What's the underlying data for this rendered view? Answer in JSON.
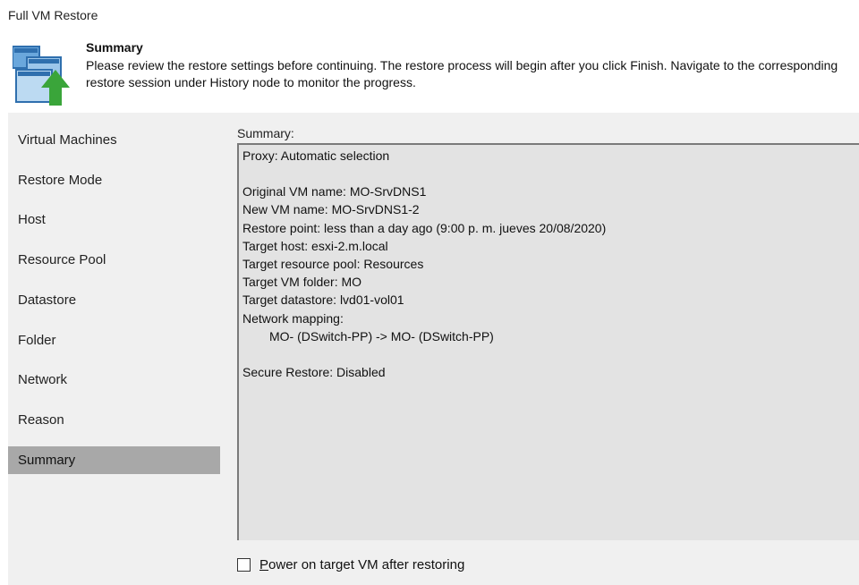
{
  "window": {
    "title": "Full VM Restore"
  },
  "header": {
    "title": "Summary",
    "description": "Please review the restore settings before continuing. The restore process will begin after you click Finish. Navigate to the corresponding restore session under History node to monitor the progress.",
    "icon": "vm-restore-icon"
  },
  "sidebar": {
    "items": [
      {
        "label": "Virtual Machines"
      },
      {
        "label": "Restore Mode"
      },
      {
        "label": "Host"
      },
      {
        "label": "Resource Pool"
      },
      {
        "label": "Datastore"
      },
      {
        "label": "Folder"
      },
      {
        "label": "Network"
      },
      {
        "label": "Reason"
      },
      {
        "label": "Summary"
      }
    ],
    "active_index": 8
  },
  "summary": {
    "label": "Summary:",
    "lines": [
      "Proxy: Automatic selection",
      "",
      "Original VM name: MO-SrvDNS1",
      "New VM name: MO-SrvDNS1-2",
      "Restore point: less than a day ago (9:00 p. m. jueves 20/08/2020)",
      "Target host: esxi-2.m.local",
      "Target resource pool: Resources",
      "Target VM folder: MO",
      "Target datastore: lvd01-vol01",
      "Network mapping:",
      "MO- (DSwitch-PP) -> MO- (DSwitch-PP)",
      "",
      "Secure Restore: Disabled"
    ]
  },
  "options": {
    "power_on_label": "Power on target VM after restoring",
    "power_on_checked": false
  },
  "colors": {
    "active_nav": "#a8a8a8",
    "panel_bg": "#f0f0f0",
    "summary_bg": "#e3e3e3",
    "icon_green": "#3aa53a",
    "icon_blue": "#4a8fd1"
  }
}
